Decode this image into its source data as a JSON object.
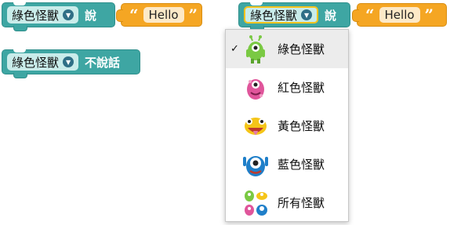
{
  "block_say": {
    "monster_field": "綠色怪獸",
    "verb": "說",
    "quote_open": "“",
    "quote_close": "”",
    "string_value": "Hello"
  },
  "block_quiet": {
    "monster_field": "綠色怪獸",
    "verb": "不說話"
  },
  "block_say_active": {
    "monster_field": "綠色怪獸",
    "verb": "說",
    "quote_open": "“",
    "quote_close": "”",
    "string_value": "Hello"
  },
  "dropdown": {
    "check_mark": "✓",
    "items": [
      {
        "label": "綠色怪獸",
        "icon": "green-monster-icon",
        "selected": true
      },
      {
        "label": "紅色怪獸",
        "icon": "pink-monster-icon",
        "selected": false
      },
      {
        "label": "黃色怪獸",
        "icon": "yellow-monster-icon",
        "selected": false
      },
      {
        "label": "藍色怪獸",
        "icon": "blue-monster-icon",
        "selected": false
      },
      {
        "label": "所有怪獸",
        "icon": "all-monsters-icon",
        "selected": false
      }
    ]
  },
  "colors": {
    "block_teal": "#3ea6a3",
    "block_orange": "#f5a623",
    "selection_yellow": "#f7c31d"
  }
}
